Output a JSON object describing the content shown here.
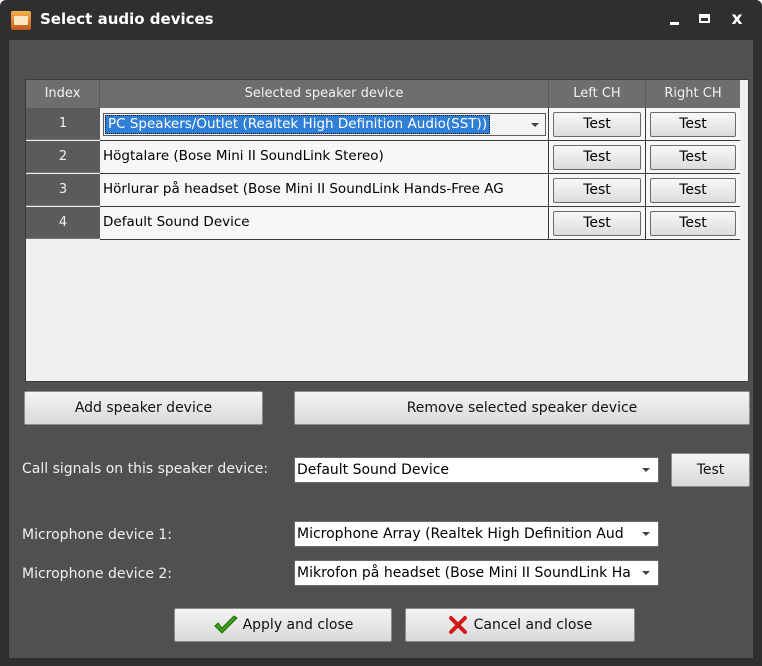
{
  "window": {
    "title": "Select audio devices",
    "minimize_symbol": "",
    "maximize_symbol": "",
    "close_symbol": "x",
    "app_icon": "audio-app-icon"
  },
  "grid": {
    "columns": {
      "index": "Index",
      "speaker": "Selected speaker device",
      "left": "Left CH",
      "right": "Right CH"
    },
    "rows": [
      {
        "index": "1",
        "device": "PC Speakers/Outlet (Realtek High Definition Audio(SST))",
        "left_btn": "Test",
        "right_btn": "Test"
      },
      {
        "index": "2",
        "device": "Högtalare (Bose Mini II SoundLink Stereo)",
        "left_btn": "Test",
        "right_btn": "Test"
      },
      {
        "index": "3",
        "device": "Hörlurar på headset (Bose Mini II SoundLink Hands-Free AG",
        "left_btn": "Test",
        "right_btn": "Test"
      },
      {
        "index": "4",
        "device": "Default Sound Device",
        "left_btn": "Test",
        "right_btn": "Test"
      }
    ]
  },
  "actions": {
    "add": "Add speaker device",
    "remove": "Remove selected speaker device"
  },
  "call_signal": {
    "label": "Call signals on this speaker device:",
    "value": "Default Sound Device",
    "test": "Test"
  },
  "mic1": {
    "label": "Microphone device 1:",
    "value": "Microphone Array (Realtek High Definition Aud"
  },
  "mic2": {
    "label": "Microphone device 2:",
    "value": "Mikrofon på headset (Bose Mini II SoundLink Ha"
  },
  "footer": {
    "apply": "Apply and close",
    "cancel": "Cancel and close"
  },
  "colors": {
    "accent": "#2f7fd6",
    "background": "#505050",
    "titlebar": "#2f2f2f",
    "apply_icon": "#3aa019",
    "cancel_icon": "#d11a1a"
  }
}
